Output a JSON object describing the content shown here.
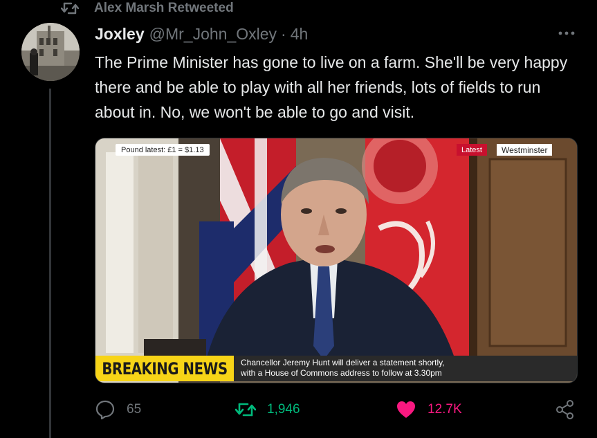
{
  "social_context": {
    "text": "Alex Marsh Retweeted",
    "icon": "retweet-icon"
  },
  "tweet": {
    "display_name": "Joxley",
    "handle": "@Mr_John_Oxley",
    "separator": "·",
    "time": "4h",
    "text": "The Prime Minister has gone to live on a farm. She'll be very happy there and be able to play with all her friends, lots of fields to run about in. No, we won't be able to go and visit."
  },
  "media": {
    "pound_ticker": "Pound latest: £1 = $1.13",
    "latest_label": "Latest",
    "location_label": "Westminster",
    "breaking_label": "BREAKING NEWS",
    "breaking_line1": "Chancellor Jeremy Hunt will deliver a statement shortly,",
    "breaking_line2": "with a House of Commons address to follow at 3.30pm"
  },
  "actions": {
    "replies": "65",
    "retweets": "1,946",
    "likes": "12.7K"
  },
  "colors": {
    "retweet_green": "#00ba7c",
    "like_pink": "#f91880",
    "muted_grey": "#71767b",
    "breaking_yellow": "#f7d417"
  }
}
